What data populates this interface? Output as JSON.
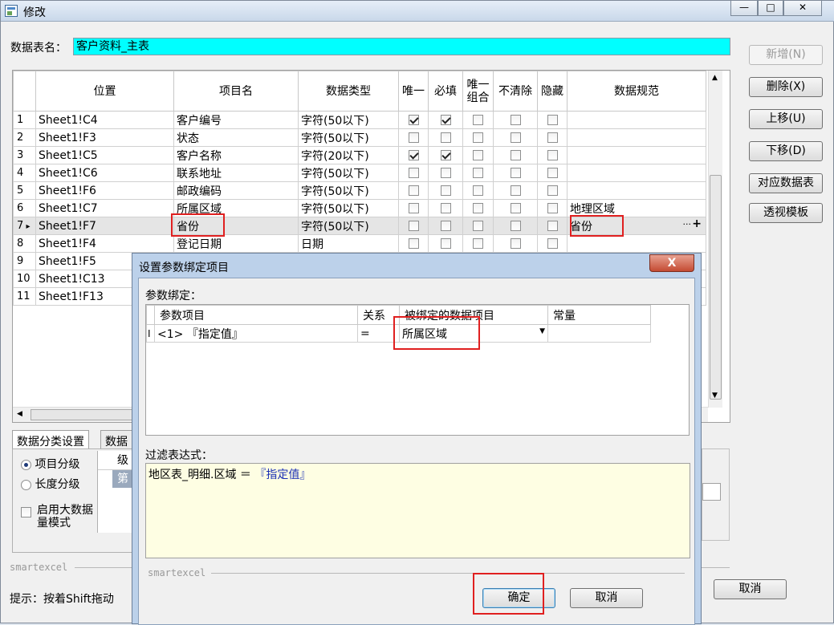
{
  "window": {
    "title": "修改",
    "min": "—",
    "max": "□",
    "close": "✕"
  },
  "table_name": {
    "label": "数据表名：",
    "value": "客户资料_主表"
  },
  "side_buttons": [
    {
      "label": "新增(N)",
      "enabled": false
    },
    {
      "label": "删除(X)",
      "enabled": true
    },
    {
      "label": "上移(U)",
      "enabled": true
    },
    {
      "label": "下移(D)",
      "enabled": true
    },
    {
      "label": "对应数据表",
      "enabled": true
    },
    {
      "label": "透视模板",
      "enabled": true
    }
  ],
  "grid": {
    "columns": [
      "",
      "位置",
      "项目名",
      "数据类型",
      "唯一",
      "必填",
      "唯一\n组合",
      "不清除",
      "隐藏",
      "数据规范"
    ],
    "rows": [
      {
        "n": "1",
        "pos": "Sheet1!C4",
        "name": "客户编号",
        "type": "字符(50以下)",
        "unique": true,
        "required": true,
        "combo": false,
        "noclear": false,
        "hidden": false,
        "spec": ""
      },
      {
        "n": "2",
        "pos": "Sheet1!F3",
        "name": "状态",
        "type": "字符(50以下)",
        "unique": false,
        "required": false,
        "combo": false,
        "noclear": false,
        "hidden": false,
        "spec": ""
      },
      {
        "n": "3",
        "pos": "Sheet1!C5",
        "name": "客户名称",
        "type": "字符(20以下)",
        "unique": true,
        "required": true,
        "combo": false,
        "noclear": false,
        "hidden": false,
        "spec": ""
      },
      {
        "n": "4",
        "pos": "Sheet1!C6",
        "name": "联系地址",
        "type": "字符(50以下)",
        "unique": false,
        "required": false,
        "combo": false,
        "noclear": false,
        "hidden": false,
        "spec": ""
      },
      {
        "n": "5",
        "pos": "Sheet1!F6",
        "name": "邮政编码",
        "type": "字符(50以下)",
        "unique": false,
        "required": false,
        "combo": false,
        "noclear": false,
        "hidden": false,
        "spec": ""
      },
      {
        "n": "6",
        "pos": "Sheet1!C7",
        "name": "所属区域",
        "type": "字符(50以下)",
        "unique": false,
        "required": false,
        "combo": false,
        "noclear": false,
        "hidden": false,
        "spec": "地理区域"
      },
      {
        "n": "7",
        "pos": "Sheet1!F7",
        "name": "省份",
        "type": "字符(50以下)",
        "unique": false,
        "required": false,
        "combo": false,
        "noclear": false,
        "hidden": false,
        "spec": "省份",
        "selected": true
      },
      {
        "n": "8",
        "pos": "Sheet1!F4",
        "name": "登记日期",
        "type": "日期",
        "unique": false,
        "required": false,
        "combo": false,
        "noclear": false,
        "hidden": false,
        "spec": ""
      },
      {
        "n": "9",
        "pos": "Sheet1!F5",
        "name": "",
        "type": "",
        "spec": ""
      },
      {
        "n": "10",
        "pos": "Sheet1!C13",
        "name": "",
        "type": "",
        "spec": ""
      },
      {
        "n": "11",
        "pos": "Sheet1!F13",
        "name": "",
        "type": "",
        "spec": ""
      }
    ],
    "cell_buttons": {
      "ellipsis": "···",
      "plus": "+"
    }
  },
  "bottom_tabs": {
    "tab1": "数据分类设置",
    "tab2": "数据",
    "radio1": "项目分级",
    "radio2": "长度分级",
    "checkbox": "启用大数据量模式",
    "list_header": "级",
    "list_row": "第"
  },
  "footer": {
    "brand": "smartexcel",
    "hint": "提示：按着Shift拖动",
    "cancel": "取消"
  },
  "dialog": {
    "title": "设置参数绑定项目",
    "close": "X",
    "section_label": "参数绑定：",
    "columns": [
      "参数项目",
      "关系",
      "被绑定的数据项目",
      "常量"
    ],
    "row": {
      "marker": "I",
      "param": "<1> 『指定值』",
      "relation": "=",
      "bound": "所属区域",
      "constant": ""
    },
    "filter_label": "过滤表达式：",
    "filter_prefix": "地区表_明细.区域 ＝ ",
    "filter_value": "『指定值』",
    "brand": "smartexcel",
    "ok": "确定",
    "cancel": "取消"
  }
}
